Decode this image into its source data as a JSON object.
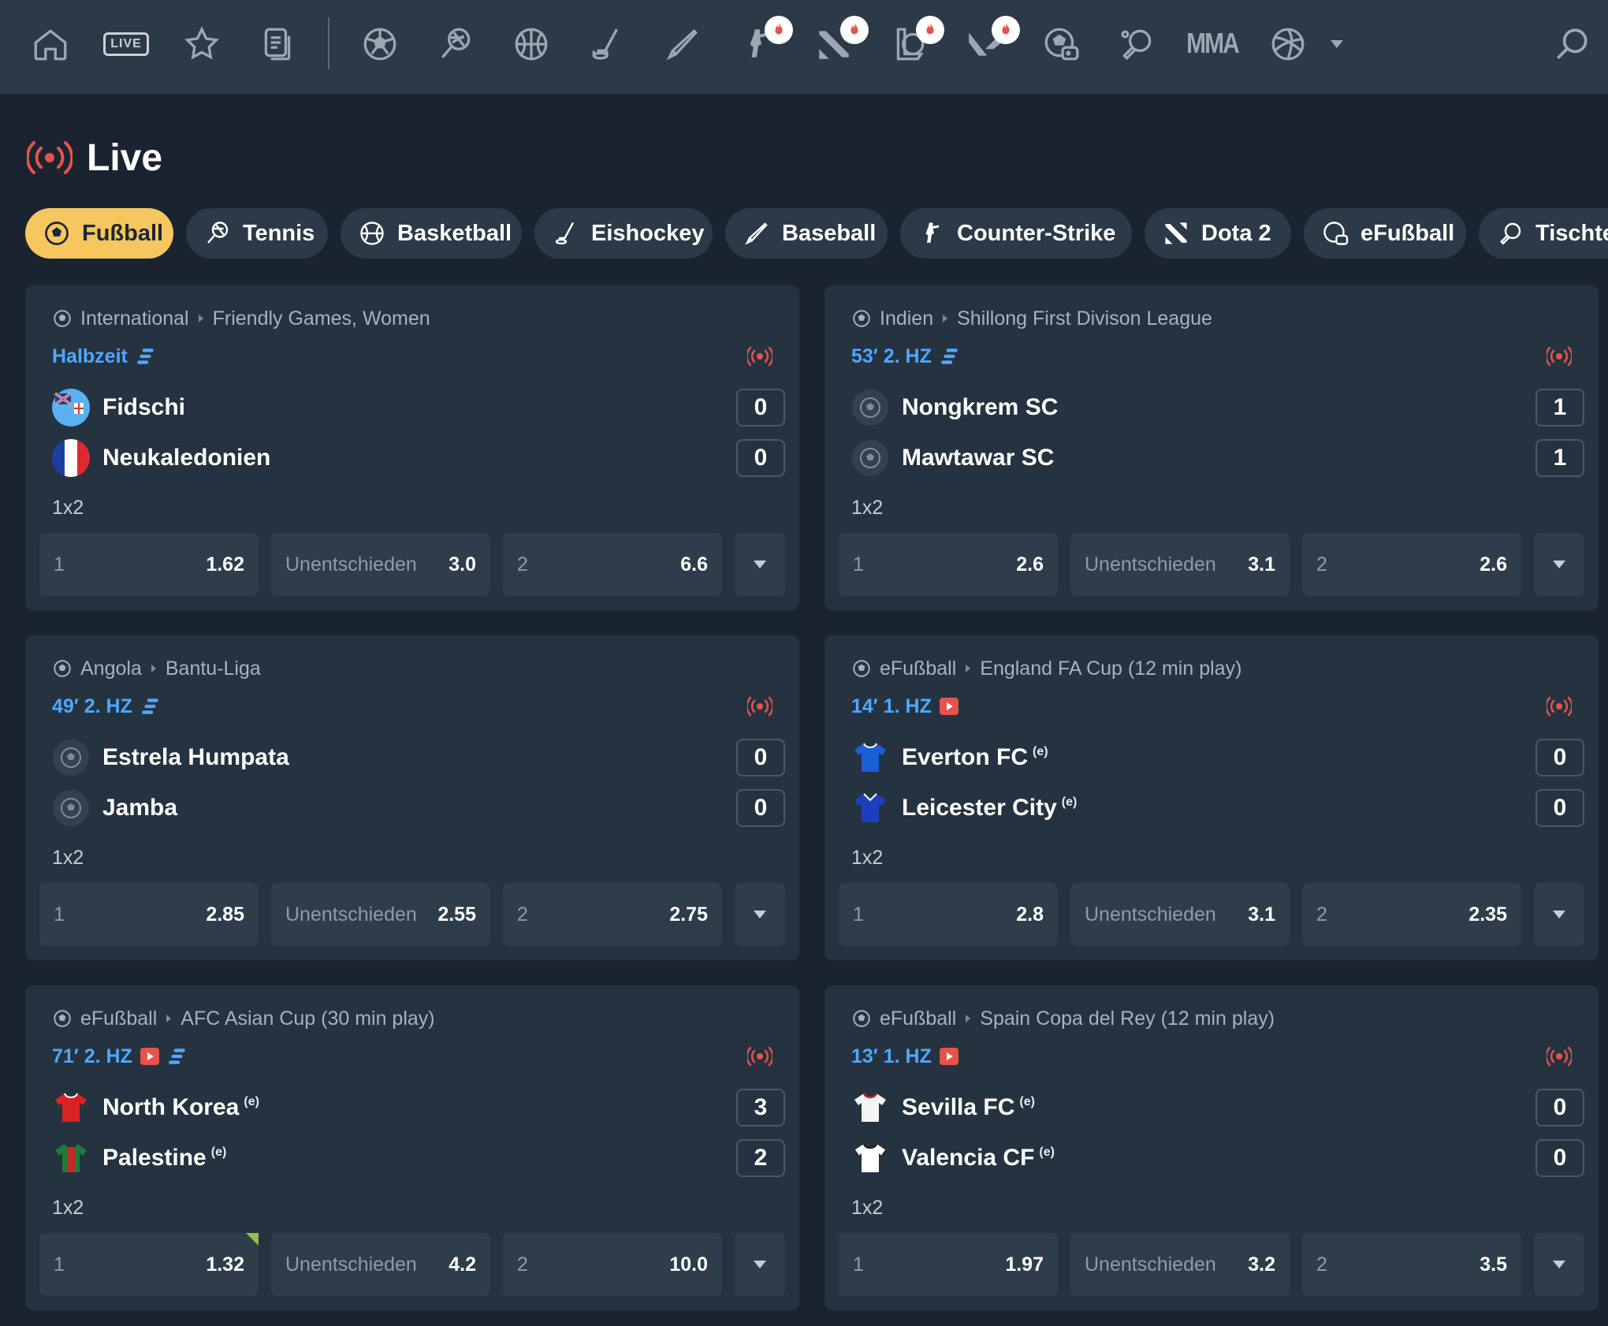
{
  "nav": {
    "live_label": "LIVE",
    "mma_label": "MMA",
    "icons": [
      "home-icon",
      "live-icon",
      "star-icon",
      "betslip-icon",
      "soccer-icon",
      "tennis-icon",
      "basketball-icon",
      "hockey-icon",
      "baseball-icon",
      "counter-strike-icon",
      "dota-icon",
      "lol-icon",
      "valorant-icon",
      "efootball-icon",
      "table-tennis-icon",
      "mma-icon",
      "volleyball-icon",
      "search-icon"
    ]
  },
  "heading": {
    "title": "Live"
  },
  "colors": {
    "accent": "#f5c75e",
    "live_red": "#e5534b",
    "status_blue": "#4ea8ff",
    "card_bg": "#253240",
    "page_bg": "#1a2430"
  },
  "pills": [
    {
      "label": "Fußball",
      "icon": "soccer-icon"
    },
    {
      "label": "Tennis",
      "icon": "tennis-icon"
    },
    {
      "label": "Basketball",
      "icon": "basketball-icon"
    },
    {
      "label": "Eishockey",
      "icon": "hockey-icon"
    },
    {
      "label": "Baseball",
      "icon": "baseball-icon"
    },
    {
      "label": "Counter-Strike",
      "icon": "counter-strike-icon"
    },
    {
      "label": "Dota 2",
      "icon": "dota-icon"
    },
    {
      "label": "eFußball",
      "icon": "efootball-icon"
    },
    {
      "label": "Tischtennis",
      "icon": "table-tennis-icon"
    }
  ],
  "matches": [
    {
      "country": "International",
      "league": "Friendly Games, Women",
      "status": "Halbzeit",
      "home": {
        "name": "Fidschi",
        "score": "0"
      },
      "away": {
        "name": "Neukaledonien",
        "score": "0"
      },
      "market": "1x2",
      "odds": {
        "l1": "1",
        "v1": "1.62",
        "lx": "Unentschieden",
        "vx": "3.0",
        "l2": "2",
        "v2": "6.6"
      }
    },
    {
      "country": "Indien",
      "league": "Shillong First Divison League",
      "status": "53′ 2. HZ",
      "home": {
        "name": "Nongkrem SC",
        "score": "1"
      },
      "away": {
        "name": "Mawtawar SC",
        "score": "1"
      },
      "market": "1x2",
      "odds": {
        "l1": "1",
        "v1": "2.6",
        "lx": "Unentschieden",
        "vx": "3.1",
        "l2": "2",
        "v2": "2.6"
      }
    },
    {
      "country": "Angola",
      "league": "Bantu-Liga",
      "status": "49′ 2. HZ",
      "home": {
        "name": "Estrela Humpata",
        "score": "0"
      },
      "away": {
        "name": "Jamba",
        "score": "0"
      },
      "market": "1x2",
      "odds": {
        "l1": "1",
        "v1": "2.85",
        "lx": "Unentschieden",
        "vx": "2.55",
        "l2": "2",
        "v2": "2.75"
      }
    },
    {
      "country": "eFußball",
      "league": "England FA Cup (12 min play)",
      "status": "14′ 1. HZ",
      "home": {
        "name": "Everton FC",
        "score": "0",
        "e": "(e)"
      },
      "away": {
        "name": "Leicester City",
        "score": "0",
        "e": "(e)"
      },
      "market": "1x2",
      "odds": {
        "l1": "1",
        "v1": "2.8",
        "lx": "Unentschieden",
        "vx": "3.1",
        "l2": "2",
        "v2": "2.35"
      }
    },
    {
      "country": "eFußball",
      "league": "AFC Asian Cup (30 min play)",
      "status": "71′ 2. HZ",
      "home": {
        "name": "North Korea",
        "score": "3",
        "e": "(e)"
      },
      "away": {
        "name": "Palestine",
        "score": "2",
        "e": "(e)"
      },
      "market": "1x2",
      "odds": {
        "l1": "1",
        "v1": "1.32",
        "lx": "Unentschieden",
        "vx": "4.2",
        "l2": "2",
        "v2": "10.0"
      }
    },
    {
      "country": "eFußball",
      "league": "Spain Copa del Rey (12 min play)",
      "status": "13′ 1. HZ",
      "home": {
        "name": "Sevilla FC",
        "score": "0",
        "e": "(e)"
      },
      "away": {
        "name": "Valencia CF",
        "score": "0",
        "e": "(e)"
      },
      "market": "1x2",
      "odds": {
        "l1": "1",
        "v1": "1.97",
        "lx": "Unentschieden",
        "vx": "3.2",
        "l2": "2",
        "v2": "3.5"
      }
    }
  ]
}
